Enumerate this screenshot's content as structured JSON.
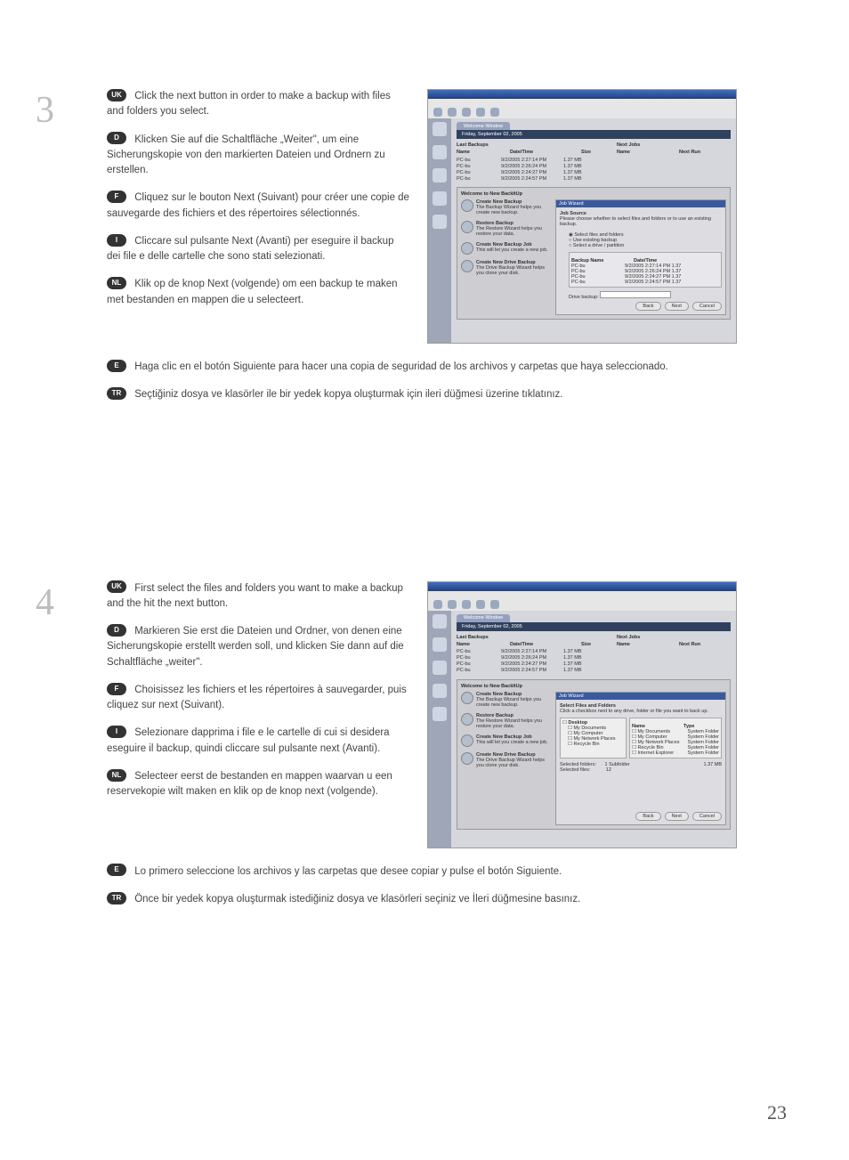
{
  "page_number": "23",
  "steps": [
    {
      "num": "3",
      "langs": {
        "uk": {
          "code": "UK",
          "text": "Click the next button in order to make a backup with files and folders you select."
        },
        "d": {
          "code": "D",
          "text": "Klicken Sie auf die Schaltfläche „Weiter\", um eine Sicherungskopie von den markierten Dateien und Ordnern zu erstellen."
        },
        "f": {
          "code": "F",
          "text": "Cliquez sur le bouton Next (Suivant) pour créer une copie de sauvegarde des fichiers et des répertoires sélectionnés."
        },
        "i": {
          "code": "I",
          "text": "Cliccare sul pulsante Next (Avanti) per eseguire il backup dei file e delle cartelle che sono stati selezionati."
        },
        "nl": {
          "code": "NL",
          "text": "Klik op de knop Next (volgende) om een backup te maken met bestanden en mappen die u selecteert."
        },
        "e": {
          "code": "E",
          "text": "Haga clic en el botón Siguiente para hacer una copia de seguridad de los archivos y carpetas que haya seleccionado."
        },
        "tr": {
          "code": "TR",
          "text": "Seçtiğiniz dosya ve klasörler ile bir yedek kopya oluşturmak için ileri düğmesi üzerine tıklatınız."
        }
      },
      "screenshot": {
        "welcome_tab": "Welcome Window",
        "date_bar": "Friday, September 02, 2005",
        "last_backups_label": "Last Backups",
        "next_jobs_label": "Next Jobs",
        "cols": {
          "name": "Name",
          "date": "Date/Time",
          "size": "Size",
          "next_name": "Name",
          "next_run": "Next Run"
        },
        "rows": [
          {
            "name": "PC-bu",
            "date": "9/2/2005 2:27:14 PM",
            "size": "1.37 MB"
          },
          {
            "name": "PC-bu",
            "date": "9/2/2005 2:26:24 PM",
            "size": "1.37 MB"
          },
          {
            "name": "PC-bu",
            "date": "9/2/2005 2:24:27 PM",
            "size": "1.37 MB"
          },
          {
            "name": "PC-bu",
            "date": "9/2/2005 2:24:57 PM",
            "size": "1.37 MB"
          }
        ],
        "wizard_header": "Welcome to New BackItUp",
        "wizard_items": [
          {
            "title": "Create New Backup",
            "desc": "The Backup Wizard helps you create new backup."
          },
          {
            "title": "Restore Backup",
            "desc": "The Restore Wizard helps you restore your data."
          },
          {
            "title": "Create New Backup Job",
            "desc": "This will let you create a new job."
          },
          {
            "title": "Create New Drive Backup",
            "desc": "The Drive Backup Wizard helps you clone your disk."
          }
        ],
        "panel_title_bar": "Job Wizard",
        "panel_title": "Job Source",
        "panel_sub": "Please choose whether to select files and folders or to use an existing backup.",
        "radios": [
          "Select files and folders",
          "Use existing backup",
          "Select a drive / partition"
        ],
        "mini_cols": {
          "name": "Backup Name",
          "date": "Date/Time"
        },
        "mini_rows": [
          {
            "n": "PC-bu",
            "d": "9/2/2005 2:27:14 PM",
            "s": "1.37"
          },
          {
            "n": "PC-bu",
            "d": "9/2/2005 2:26:24 PM",
            "s": "1.37"
          },
          {
            "n": "PC-bu",
            "d": "9/2/2005 2:24:27 PM",
            "s": "1.37"
          },
          {
            "n": "PC-bu",
            "d": "9/2/2005 2:24:57 PM",
            "s": "1.37"
          }
        ],
        "drive_label": "Drive backup:",
        "buttons": {
          "back": "Back",
          "next": "Next",
          "cancel": "Cancel"
        }
      }
    },
    {
      "num": "4",
      "langs": {
        "uk": {
          "code": "UK",
          "text": "First select the files and folders you want to make a backup and the hit the next button."
        },
        "d": {
          "code": "D",
          "text": "Markieren Sie erst die Dateien und Ordner, von denen eine Sicherungskopie erstellt werden soll, und klicken Sie dann auf die Schaltfläche „weiter\"."
        },
        "f": {
          "code": "F",
          "text": "Choisissez les fichiers et les répertoires à sauvegarder, puis cliquez sur next (Suivant)."
        },
        "i": {
          "code": "I",
          "text": "Selezionare dapprima i file e le cartelle di cui si desidera eseguire il backup, quindi cliccare sul pulsante next (Avanti)."
        },
        "nl": {
          "code": "NL",
          "text": "Selecteer eerst de bestanden en mappen waarvan u een reservekopie wilt maken en klik op de knop next (volgende)."
        },
        "e": {
          "code": "E",
          "text": "Lo primero seleccione los archivos y las carpetas que desee copiar y pulse el botón Siguiente."
        },
        "tr": {
          "code": "TR",
          "text": "Önce bir yedek kopya oluşturmak istediğiniz dosya ve klasörleri seçiniz ve İleri düğmesine basınız."
        }
      },
      "screenshot": {
        "welcome_tab": "Welcome Window",
        "date_bar": "Friday, September 02, 2005",
        "last_backups_label": "Last Backups",
        "next_jobs_label": "Next Jobs",
        "cols": {
          "name": "Name",
          "date": "Date/Time",
          "size": "Size",
          "next_name": "Name",
          "next_run": "Next Run"
        },
        "rows": [
          {
            "name": "PC-bu",
            "date": "9/2/2005 2:27:14 PM",
            "size": "1.37 MB"
          },
          {
            "name": "PC-bu",
            "date": "9/2/2005 2:26:24 PM",
            "size": "1.37 MB"
          },
          {
            "name": "PC-bu",
            "date": "9/2/2005 2:24:27 PM",
            "size": "1.37 MB"
          },
          {
            "name": "PC-bu",
            "date": "9/2/2005 2:24:57 PM",
            "size": "1.37 MB"
          }
        ],
        "wizard_header": "Welcome to New BackItUp",
        "wizard_items": [
          {
            "title": "Create New Backup",
            "desc": "The Backup Wizard helps you create new backup."
          },
          {
            "title": "Restore Backup",
            "desc": "The Restore Wizard helps you restore your data."
          },
          {
            "title": "Create New Backup Job",
            "desc": "This will let you create a new job."
          },
          {
            "title": "Create New Drive Backup",
            "desc": "The Drive Backup Wizard helps you clone your disk."
          }
        ],
        "panel_title_bar": "Job Wizard",
        "panel_title": "Select Files and Folders",
        "panel_sub": "Click a checkbox next to any drive, folder or file you want to back up.",
        "tree_left": [
          "Desktop",
          "My Documents",
          "My Computer",
          "My Network Places",
          "Recycle Bin"
        ],
        "tree_right_name": "Name",
        "tree_right_type": "Type",
        "tree_right": [
          {
            "n": "My Documents",
            "t": "System Folder"
          },
          {
            "n": "My Computer",
            "t": "System Folder"
          },
          {
            "n": "My Network Places",
            "t": "System Folder"
          },
          {
            "n": "Recycle Bin",
            "t": "System Folder"
          },
          {
            "n": "Internet Explorer",
            "t": "System Folder"
          }
        ],
        "selected_folders_label": "Selected folders:",
        "selected_folders_val": "1   Subfolder",
        "selected_files_label": "Selected files:",
        "selected_files_val": "12",
        "size_val": "1.37 MB",
        "buttons": {
          "back": "Back",
          "next": "Next",
          "cancel": "Cancel"
        }
      }
    }
  ]
}
